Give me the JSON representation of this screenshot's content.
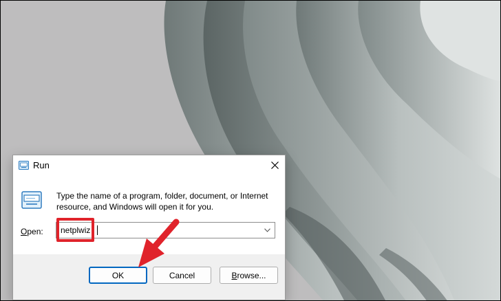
{
  "dialog": {
    "title": "Run",
    "close_glyph": "✕",
    "description": "Type the name of a program, folder, document, or Internet resource, and Windows will open it for you.",
    "open_label_underlined": "O",
    "open_label_rest": "pen:",
    "input_value": "netplwiz",
    "buttons": {
      "ok": "OK",
      "cancel": "Cancel",
      "browse_underlined": "B",
      "browse_rest": "rowse..."
    }
  },
  "annotations": {
    "highlight_color": "#e0232b",
    "arrow_color": "#e0232b"
  },
  "icons": [
    "run-title-icon",
    "close-icon",
    "run-program-icon",
    "chevron-down-icon",
    "red-arrow"
  ]
}
